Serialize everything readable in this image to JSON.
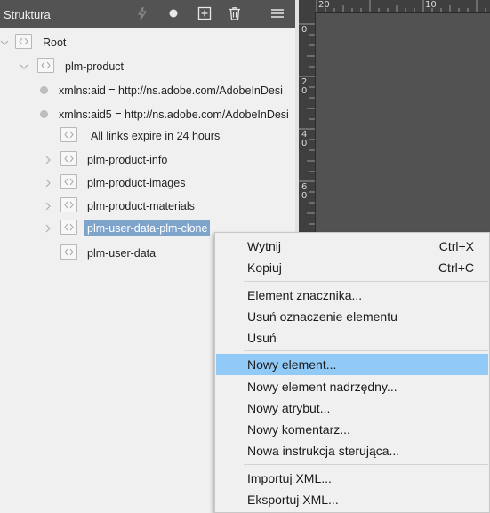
{
  "panel": {
    "title": "Struktura",
    "header_icons": [
      "lightning-icon",
      "dot-icon",
      "add-box-icon",
      "trash-icon",
      "menu-icon"
    ]
  },
  "tree": [
    {
      "kind": "element",
      "label": "Root",
      "expanded": true
    },
    {
      "kind": "element",
      "label": "plm-product",
      "expanded": true
    },
    {
      "kind": "attribute",
      "label": "xmlns:aid = http://ns.adobe.com/AdobeInDesi"
    },
    {
      "kind": "attribute",
      "label": "xmlns:aid5 = http://ns.adobe.com/AdobeInDesi"
    },
    {
      "kind": "element",
      "label": "All links expire in 24 hours"
    },
    {
      "kind": "element",
      "label": "plm-product-info",
      "expandable": true
    },
    {
      "kind": "element",
      "label": "plm-product-images",
      "expandable": true
    },
    {
      "kind": "element",
      "label": "plm-product-materials",
      "expandable": true
    },
    {
      "kind": "element",
      "label": "plm-user-data-plm-clone",
      "expandable": true,
      "selected": true
    },
    {
      "kind": "element",
      "label": "plm-user-data"
    }
  ],
  "ruler": {
    "top": [
      "20",
      "10"
    ],
    "left": [
      "0",
      "2\n0",
      "4\n0",
      "6\n0"
    ]
  },
  "menu": {
    "items": [
      {
        "label": "Wytnij",
        "shortcut": "Ctrl+X"
      },
      {
        "label": "Kopiuj",
        "shortcut": "Ctrl+C"
      },
      {
        "label": "Element znacznika...",
        "shortcut": ""
      },
      {
        "label": "Usuń oznaczenie elementu",
        "shortcut": ""
      },
      {
        "label": "Usuń",
        "shortcut": ""
      },
      {
        "label": "Nowy element...",
        "shortcut": "",
        "highlighted": true
      },
      {
        "label": "Nowy element nadrzędny...",
        "shortcut": ""
      },
      {
        "label": "Nowy atrybut...",
        "shortcut": ""
      },
      {
        "label": "Nowy komentarz...",
        "shortcut": ""
      },
      {
        "label": "Nowa instrukcja sterująca...",
        "shortcut": ""
      },
      {
        "label": "Importuj XML...",
        "shortcut": ""
      },
      {
        "label": "Eksportuj XML...",
        "shortcut": ""
      }
    ]
  },
  "colors": {
    "selection": "#7fa4cb",
    "menu_highlight": "#91c9f7",
    "header_bg": "#535353"
  }
}
